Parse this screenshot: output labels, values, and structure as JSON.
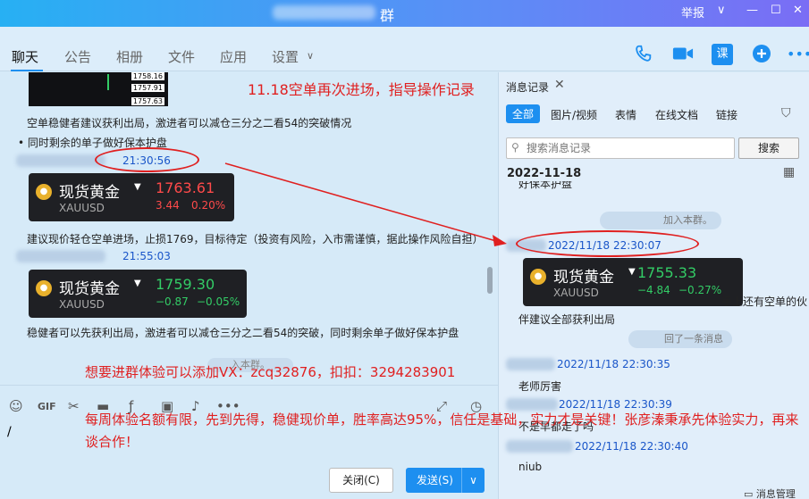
{
  "titlebar": {
    "title": "群",
    "report": "举报",
    "chevron": "∨",
    "minimize": "—",
    "maximize": "☐",
    "close": "✕"
  },
  "tabs": [
    "聊天",
    "公告",
    "相册",
    "文件",
    "应用",
    "设置"
  ],
  "toolbar_icons": [
    "phone-icon",
    "video-icon",
    "course-icon",
    "add-icon",
    "more-icon"
  ],
  "course_label": "课",
  "chat": {
    "chart_labels": [
      "1758.16",
      "1757.91",
      "1757.63"
    ],
    "msg1": "空单稳健者建议获利出局，激进者可以减仓三分之二看54的突破情况",
    "msg2": "同时剩余的单子做好保本护盘",
    "time1": "21:30:56",
    "card1": {
      "name": "现货黄金",
      "symbol": "XAUUSD",
      "price": "1763.61",
      "change": "3.44",
      "pct": "0.20%"
    },
    "msg3": "建议现价轻仓空单进场，止损1769，目标待定（投资有风险，入市需谨慎，据此操作风险自担）",
    "time2": "21:55:03",
    "card2": {
      "name": "现货黄金",
      "symbol": "XAUUSD",
      "price": "1759.30",
      "change": "−0.87",
      "pct": "−0.05%"
    },
    "msg4": "稳健者可以先获利出局，激进者可以减仓三分之二看54的突破，同时剩余单子做好保本护盘",
    "join": "入本群。"
  },
  "annotations": {
    "note1": "11.18空单再次进场，指导操作记录",
    "note2": "想要进群体验可以添加VX：zcq32876，扣扣：3294283901",
    "note3": "每周体验名额有限，先到先得，稳健现价单，胜率高达95%，信任是基础，实力才是关键！张彦溱秉承先体验实力，再来谈合作！"
  },
  "input": {
    "cursor": "/",
    "close_btn": "关闭(C)",
    "send_btn": "发送(S)",
    "send_dd": "∨"
  },
  "panel": {
    "title": "消息记录",
    "close": "✕",
    "filters": [
      "全部",
      "图片/视频",
      "表情",
      "在线文档",
      "链接"
    ],
    "search_placeholder": "搜索消息记录",
    "search_btn": "搜索",
    "date": "2022-11-18",
    "cut_top": "好保本护盘",
    "join_pill": "加入本群。",
    "time1": "2022/11/18 22:30:07",
    "card": {
      "name": "现货黄金",
      "symbol": "XAUUSD",
      "price": "1755.33",
      "change": "−4.84",
      "pct": "−0.27%"
    },
    "side_text": "手上还有空单的伙",
    "side_text2": "伴建议全部获利出局",
    "recall_pill": "回了一条消息",
    "time2": "2022/11/18 22:30:35",
    "msg2": "老师厉害",
    "time3": "2022/11/18 22:30:39",
    "msg3": "不是早都走了吗",
    "time4": "2022/11/18 22:30:40",
    "msg4": "niub",
    "manage": "消息管理"
  }
}
